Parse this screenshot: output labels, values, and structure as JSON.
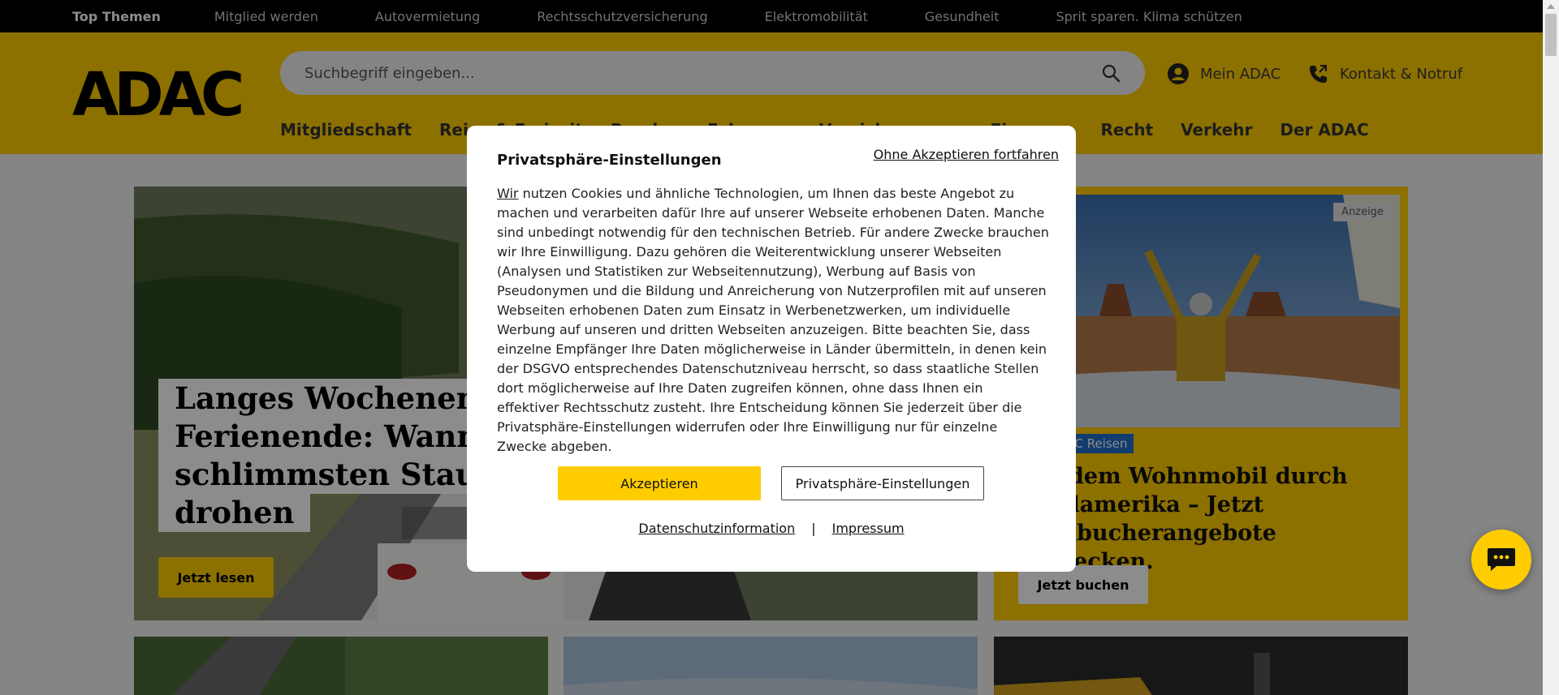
{
  "topbar": {
    "items": [
      "Top Themen",
      "Mitglied werden",
      "Autovermietung",
      "Rechtsschutzversicherung",
      "Elektromobilität",
      "Gesundheit",
      "Sprit sparen. Klima schützen"
    ]
  },
  "header": {
    "logo": "ADAC",
    "search_placeholder": "Suchbegriff eingeben...",
    "mein_adac": "Mein ADAC",
    "kontakt": "Kontakt & Notruf",
    "nav": [
      "Mitgliedschaft",
      "Reise & Freizeit",
      "Rund ums Fahrzeug",
      "Versicherungen",
      "Finanzen",
      "Recht",
      "Verkehr",
      "Der ADAC"
    ]
  },
  "hero": {
    "title_lines": [
      "Langes Wochenende &",
      "Ferienende: Wann die",
      "schlimmsten Staus",
      "drohen"
    ],
    "button": "Jetzt lesen"
  },
  "ad": {
    "label": "Anzeige",
    "tag": "ADAC Reisen",
    "title": "Mit dem Wohnmobil durch Nordamerika – Jetzt Frühbucherangebote entdecken.",
    "button": "Jetzt buchen"
  },
  "modal": {
    "title": "Privatsphäre-Einstellungen",
    "skip": "Ohne Akzeptieren fortfahren",
    "text_first": "Wir",
    "text_rest": " nutzen Cookies und ähnliche Technologien, um Ihnen das beste Angebot zu machen und verarbeiten dafür Ihre auf unserer Webseite erhobenen Daten. Manche sind unbedingt notwendig für den technischen Betrieb. Für andere Zwecke brauchen wir Ihre Einwilligung. Dazu gehören die Weiterentwicklung unserer Webseiten (Analysen und Statistiken zur Webseitennutzung), Werbung auf Basis von Pseudonymen und die Bildung und Anreicherung von Nutzerprofilen mit auf unseren Webseiten erhobenen Daten zum Einsatz in Werbenetzwerken, um individuelle Werbung auf unseren und dritten Webseiten anzuzeigen. Bitte beachten Sie, dass einzelne Empfänger Ihre Daten möglicherweise in Länder übermitteln, in denen kein der DSGVO entsprechendes Datenschutzniveau herrscht, so dass staatliche Stellen dort möglicherweise auf Ihre Daten zugreifen können, ohne dass Ihnen ein effektiver Rechtsschutz zusteht. Ihre Entscheidung können Sie jederzeit über die Privatsphäre-Einstellungen widerrufen oder Ihre Einwilligung nur für einzelne Zwecke abgeben.",
    "accept": "Akzeptieren",
    "settings": "Privatsphäre-Einstellungen",
    "link_privacy": "Datenschutzinformation",
    "separator": "|",
    "link_imprint": "Impressum"
  },
  "colors": {
    "brand_yellow": "#ffcc00",
    "topbar_bg": "#000000",
    "tag_blue": "#1f6ec8"
  },
  "icons": [
    "search-icon",
    "account-icon",
    "phone-icon",
    "chat-icon"
  ]
}
